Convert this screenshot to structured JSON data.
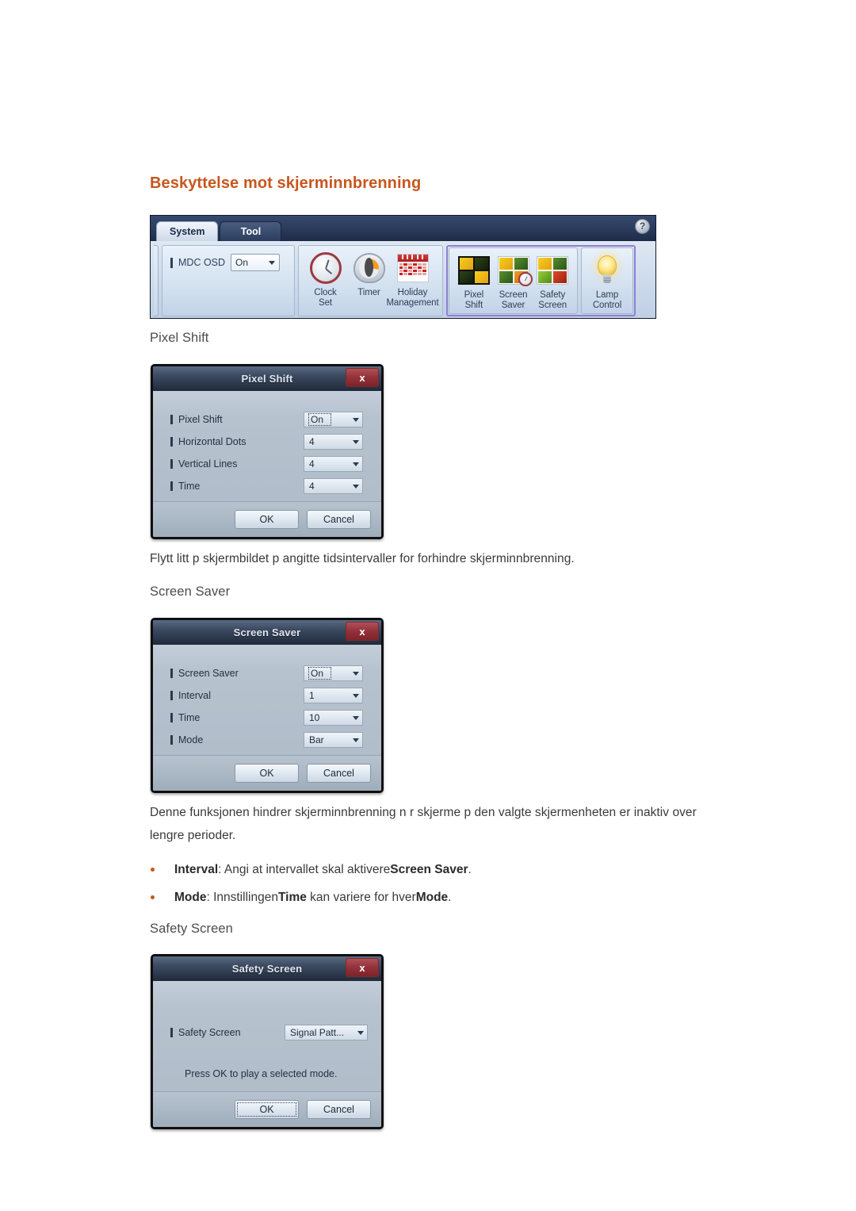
{
  "page": {
    "heading": "Beskyttelse mot skjerminnbrenning",
    "heading_color": "#C8561E"
  },
  "toolbar": {
    "tabs": [
      {
        "label": "System",
        "active": true
      },
      {
        "label": "Tool",
        "active": false
      }
    ],
    "help_icon": "?",
    "osd": {
      "label": "MDC OSD",
      "value": "On"
    },
    "groups": [
      {
        "name": "clock-group",
        "items": [
          {
            "label_line1": "Clock",
            "label_line2": "Set",
            "icon": "clock-icon"
          },
          {
            "label_line1": "Timer",
            "label_line2": "",
            "icon": "timer-icon"
          },
          {
            "label_line1": "Holiday",
            "label_line2": "Management",
            "icon": "calendar-icon"
          }
        ]
      },
      {
        "name": "burn-in-group",
        "highlighted": true,
        "items": [
          {
            "label_line1": "Pixel",
            "label_line2": "Shift",
            "icon": "pixel-shift-icon"
          },
          {
            "label_line1": "Screen",
            "label_line2": "Saver",
            "icon": "screen-saver-icon"
          },
          {
            "label_line1": "Safety",
            "label_line2": "Screen",
            "icon": "safety-screen-icon"
          }
        ]
      },
      {
        "name": "lamp-group",
        "highlighted": true,
        "items": [
          {
            "label_line1": "Lamp",
            "label_line2": "Control",
            "icon": "lamp-icon"
          }
        ]
      }
    ]
  },
  "sections": [
    {
      "id": "pixel_shift",
      "heading": "Pixel Shift",
      "paragraph": "Flytt litt p  skjermbildet p  angitte tidsintervaller for   forhindre skjerminnbrenning."
    },
    {
      "id": "screen_saver",
      "heading": "Screen Saver",
      "paragraph_line1": "Denne funksjonen hindrer skjerminnbrenning n r skjerme p  den valgte skjermenheten er inaktiv over",
      "paragraph_line2": "lengre perioder.",
      "bullets": [
        {
          "pre_bold": "Interval",
          "mid": ": Angi at intervallet skal aktivere",
          "post_bold": "Screen Saver",
          "tail": "."
        },
        {
          "pre_bold": "Mode",
          "mid": ": Innstillingen",
          "inline_bold": "Time",
          "mid2": " kan variere for hver",
          "post_bold": "Mode",
          "tail": "."
        }
      ]
    },
    {
      "id": "safety_screen",
      "heading": "Safety Screen"
    }
  ],
  "dialogs": {
    "pixel_shift": {
      "title": "Pixel Shift",
      "close_label": "x",
      "rows": [
        {
          "label": "Pixel Shift",
          "value": "On",
          "focused": true
        },
        {
          "label": "Horizontal Dots",
          "value": "4",
          "focused": false
        },
        {
          "label": "Vertical Lines",
          "value": "4",
          "focused": false
        },
        {
          "label": "Time",
          "value": "4",
          "focused": false
        }
      ],
      "ok_label": "OK",
      "cancel_label": "Cancel"
    },
    "screen_saver": {
      "title": "Screen Saver",
      "close_label": "x",
      "rows": [
        {
          "label": "Screen Saver",
          "value": "On",
          "focused": true
        },
        {
          "label": "Interval",
          "value": "1",
          "focused": false
        },
        {
          "label": "Time",
          "value": "10",
          "focused": false
        },
        {
          "label": "Mode",
          "value": "Bar",
          "focused": false
        }
      ],
      "ok_label": "OK",
      "cancel_label": "Cancel"
    },
    "safety_screen": {
      "title": "Safety Screen",
      "close_label": "x",
      "rows": [
        {
          "label": "Safety Screen",
          "value": "Signal Patt...",
          "focused": false
        }
      ],
      "note": "Press OK to play a selected mode.",
      "ok_label": "OK",
      "cancel_label": "Cancel"
    }
  }
}
